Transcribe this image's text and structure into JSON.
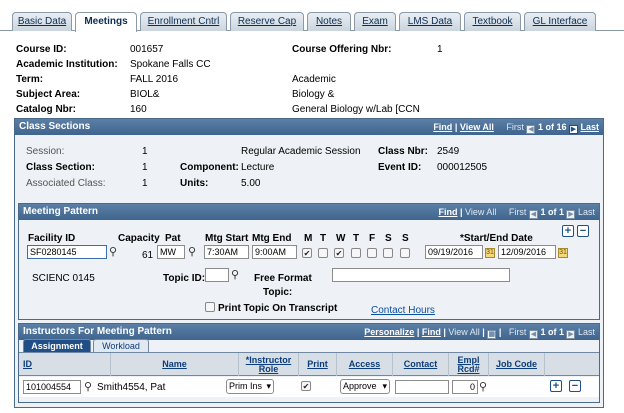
{
  "tabs": [
    {
      "label": "Basic Data"
    },
    {
      "label": "Meetings",
      "active": true
    },
    {
      "label": "Enrollment Cntrl"
    },
    {
      "label": "Reserve Cap"
    },
    {
      "label": "Notes"
    },
    {
      "label": "Exam"
    },
    {
      "label": "LMS Data"
    },
    {
      "label": "Textbook"
    },
    {
      "label": "GL Interface"
    }
  ],
  "course": {
    "course_id_label": "Course ID:",
    "course_id": "001657",
    "offering_label": "Course Offering Nbr:",
    "offering": "1",
    "institution_label": "Academic Institution:",
    "institution": "Spokane Falls CC",
    "term_label": "Term:",
    "term": "FALL 2016",
    "term_right": "Academic",
    "subject_label": "Subject Area:",
    "subject": "BIOL&",
    "subject_right": "Biology &",
    "catalog_label": "Catalog Nbr:",
    "catalog": "160",
    "catalog_right": "General Biology w/Lab   [CCN"
  },
  "class_sections": {
    "title": "Class Sections",
    "nav": {
      "find": "Find",
      "view_all": "View All",
      "first": "First",
      "range": "1 of 16",
      "last": "Last"
    },
    "session_label": "Session:",
    "session": "1",
    "session_desc": "Regular Academic Session",
    "class_nbr_label": "Class Nbr:",
    "class_nbr": "2549",
    "class_section_label": "Class Section:",
    "class_section": "1",
    "component_label": "Component:",
    "component": "Lecture",
    "event_id_label": "Event ID:",
    "event_id": "000012505",
    "assoc_class_label": "Associated Class:",
    "assoc_class": "1",
    "units_label": "Units:",
    "units": "5.00"
  },
  "meeting_pattern": {
    "title": "Meeting Pattern",
    "nav": {
      "find": "Find",
      "view_all": "View All",
      "first": "First",
      "range": "1 of 1",
      "last": "Last"
    },
    "facility_label": "Facility ID",
    "facility": "SF0280145",
    "capacity_label": "Capacity",
    "capacity": "61",
    "pat_label": "Pat",
    "pat": "MW",
    "mtg_start_label": "Mtg Start",
    "mtg_start": "7:30AM",
    "mtg_end_label": "Mtg End",
    "mtg_end": "9:00AM",
    "days": [
      {
        "label": "M",
        "checked": true
      },
      {
        "label": "T",
        "checked": false
      },
      {
        "label": "W",
        "checked": true
      },
      {
        "label": "T",
        "checked": false
      },
      {
        "label": "F",
        "checked": false
      },
      {
        "label": "S",
        "checked": false
      },
      {
        "label": "S",
        "checked": false
      }
    ],
    "dates_label": "*Start/End Date",
    "start_date": "09/19/2016",
    "end_date": "12/09/2016",
    "facility_desc": "SCIENC  0145",
    "topic_label": "Topic ID:",
    "topic": "",
    "free_format_label": "Free Format",
    "free_format_label2": "Topic:",
    "free_format": "",
    "print_topic_label": "Print Topic On Transcript",
    "contact_hours": "Contact Hours"
  },
  "instructors": {
    "title": "Instructors For Meeting Pattern",
    "nav": {
      "personalize": "Personalize",
      "find": "Find",
      "view_all": "View All",
      "first": "First",
      "range": "1 of 1",
      "last": "Last"
    },
    "subtabs": [
      "Assignment",
      "Workload"
    ],
    "headers": {
      "id": "ID",
      "name": "Name",
      "role": "*Instructor Role",
      "print": "Print",
      "access": "Access",
      "contact": "Contact",
      "empl_rcd": "Empl Rcd#",
      "job_code": "Job Code"
    },
    "row": {
      "id": "101004554",
      "name": "Smith4554, Pat",
      "role": "Prim Ins",
      "print": true,
      "access": "Approve",
      "contact": "",
      "empl_rcd": "0",
      "job_code": ""
    }
  },
  "colors": {
    "header_blue": "#3f658e",
    "panel_bg": "#eef1f5",
    "link": "#0b4ea2"
  }
}
